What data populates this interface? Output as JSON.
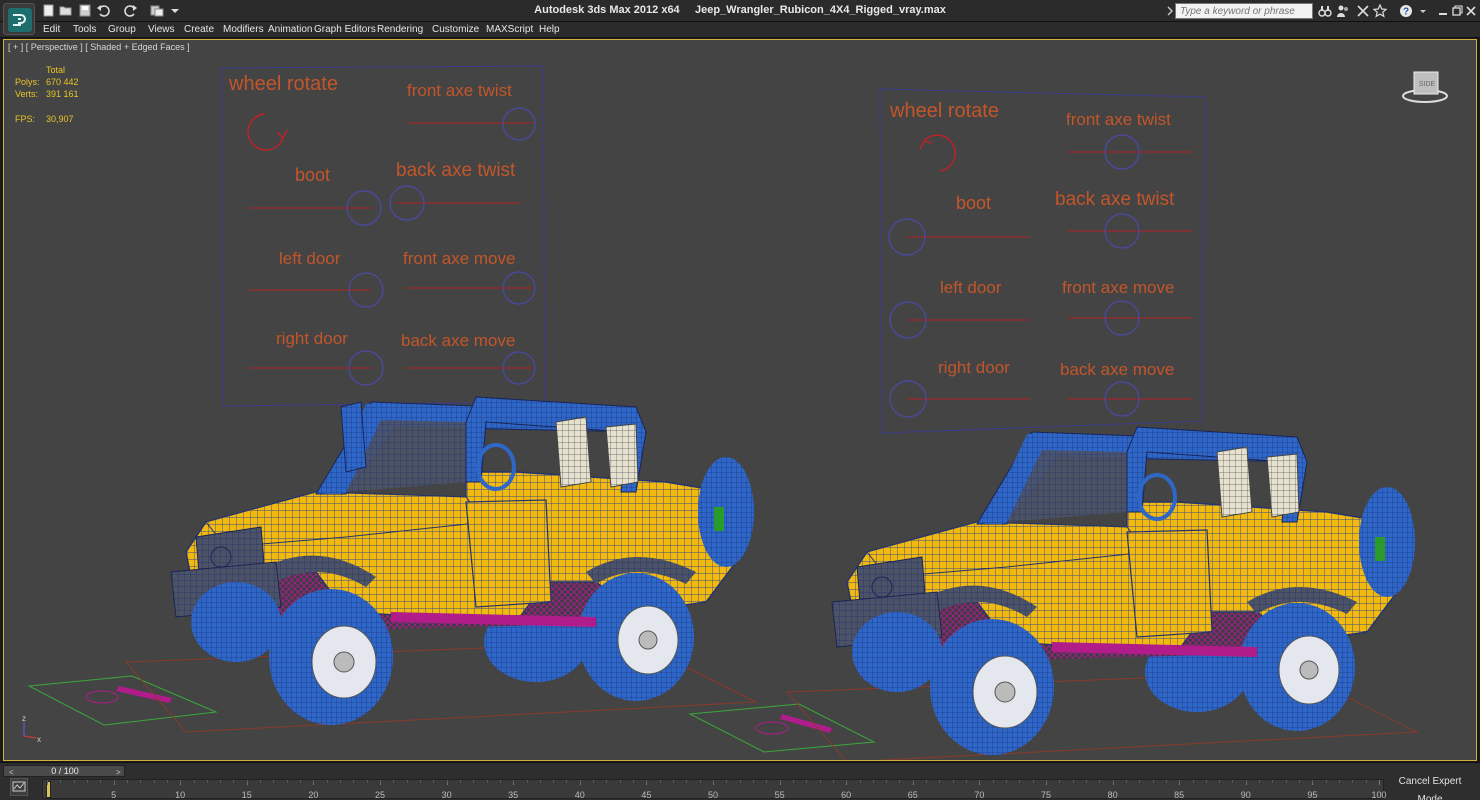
{
  "titlebar": {
    "app_name": "Autodesk 3ds Max  2012 x64",
    "file_name": "Jeep_Wrangler_Rubicon_4X4_Rigged_vray.max",
    "search_placeholder": "Type a keyword or phrase",
    "quick_access_icons": [
      "new-icon",
      "open-icon",
      "save-icon",
      "undo-icon",
      "redo-icon",
      "project-icon",
      "dropdown-icon"
    ],
    "right_icons": [
      "binoculars-icon",
      "people-icon",
      "star-icon",
      "help-icon",
      "minimize-icon",
      "restore-icon",
      "close-icon"
    ]
  },
  "menubar": {
    "items": [
      "Edit",
      "Tools",
      "Group",
      "Views",
      "Create",
      "Modifiers",
      "Animation",
      "Graph Editors",
      "Rendering",
      "Customize",
      "MAXScript",
      "Help"
    ]
  },
  "viewport": {
    "label": "[ + ] [ Perspective ] [ Shaded + Edged Faces ]",
    "stats": {
      "header": "Total",
      "polys_label": "Polys:",
      "polys_value": "670 442",
      "verts_label": "Verts:",
      "verts_value": "391 161",
      "fps_label": "FPS:",
      "fps_value": "30,907"
    },
    "viewcube_label": "SIDE",
    "axis_labels": {
      "z": "z",
      "x": "x"
    },
    "control_panels": [
      {
        "labels": {
          "wheel_rotate": "wheel rotate",
          "front_axe_twist": "front axe twist",
          "boot": "boot",
          "back_axe_twist": "back axe twist",
          "left_door": "left door",
          "front_axe_move": "front axe move",
          "right_door": "right door",
          "back_axe_move": "back axe move"
        }
      },
      {
        "labels": {
          "wheel_rotate": "wheel rotate",
          "front_axe_twist": "front axe twist",
          "boot": "boot",
          "back_axe_twist": "back axe twist",
          "left_door": "left door",
          "front_axe_move": "front axe move",
          "right_door": "right door",
          "back_axe_move": "back axe move"
        }
      }
    ],
    "colors": {
      "background": "#444444",
      "wire": "#1e3a8a",
      "body": "#f2b90f",
      "tire": "#2f67c8",
      "suspension": "#b01c8a",
      "rig_text": "#c2562a",
      "rig_frame": "#3a3a8a",
      "stats": "#e8c528"
    }
  },
  "timeline": {
    "slider_label": "0 / 100",
    "ticks": [
      "0",
      "5",
      "10",
      "15",
      "20",
      "25",
      "30",
      "35",
      "40",
      "45",
      "50",
      "55",
      "60",
      "65",
      "70",
      "75",
      "80",
      "85",
      "90",
      "95",
      "100"
    ],
    "cancel_expert_label": "Cancel Expert Mode"
  }
}
